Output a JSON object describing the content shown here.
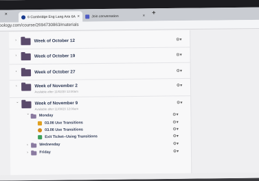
{
  "browser": {
    "tabs": [
      {
        "label": "6 Cambridge Eng Lang Arts 6A",
        "active": true,
        "icon_color": "#1a3c8f"
      },
      {
        "label": "Join conversation",
        "active": false,
        "icon_color": "#4f5bc4"
      }
    ],
    "close_glyph": "×",
    "new_tab_glyph": "+",
    "url": "oology.com/course/2694730863/materials"
  },
  "materials": {
    "folders": [
      {
        "title": "Week of October 12",
        "subtitle": ""
      },
      {
        "title": "Week of October 19",
        "subtitle": ""
      },
      {
        "title": "Week of October 27",
        "subtitle": ""
      },
      {
        "title": "Week of November 2",
        "subtitle": "Available after 11/02/20 12:00am"
      },
      {
        "title": "Week of November 9",
        "subtitle": "Available after 11/09/20 12:00am"
      }
    ],
    "expanded_folder": {
      "title": "Monday",
      "items": [
        {
          "label": "03.06 Use Transitions",
          "icon": "assignment-icon",
          "color": "#e0a020"
        },
        {
          "label": "03.06 Use Transitions",
          "icon": "discussion-icon",
          "color": "#d48a1a"
        },
        {
          "label": "Exit Ticket--Using Transitions",
          "icon": "assessment-icon",
          "color": "#3aa05a"
        }
      ]
    },
    "subfolders": [
      {
        "title": "Wednesday"
      },
      {
        "title": "Friday"
      }
    ],
    "gear_glyph": "⚙▾",
    "chevron_right": "›",
    "chevron_down": "⌄"
  }
}
